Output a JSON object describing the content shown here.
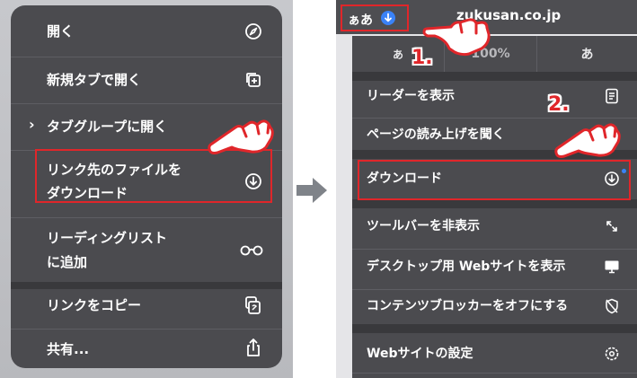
{
  "left_menu": {
    "items": [
      {
        "label": "開く",
        "icon": "compass-icon"
      },
      {
        "label": "新規タブで開く",
        "icon": "new-tab-icon"
      },
      {
        "label": "タブグループに開く",
        "chevron": "›"
      },
      {
        "label_line1": "リンク先のファイルを",
        "label_line2": "ダウンロード",
        "icon": "download-icon"
      },
      {
        "label_line1": "リーディングリスト",
        "label_line2": "に追加",
        "icon": "glasses-icon"
      },
      {
        "label": "リンクをコピー",
        "icon": "copy-icon"
      },
      {
        "label": "共有...",
        "icon": "share-icon"
      }
    ]
  },
  "right_panel": {
    "aa_label": "ぁあ",
    "url": "zukusan.co.jp",
    "font_small": "あ",
    "zoom": "100%",
    "font_large": "あ",
    "items": [
      {
        "label": "リーダーを表示",
        "icon": "reader-icon"
      },
      {
        "label": "ページの読み上げを聞く",
        "icon": "speaker-icon"
      },
      {
        "label": "ダウンロード",
        "icon": "download-icon"
      },
      {
        "label": "ツールバーを非表示",
        "icon": "resize-icon"
      },
      {
        "label": "デスクトップ用 Webサイトを表示",
        "icon": "desktop-icon"
      },
      {
        "label": "コンテンツブロッカーをオフにする",
        "icon": "blocker-off-icon"
      },
      {
        "label": "Webサイトの設定",
        "icon": "settings-icon"
      }
    ]
  },
  "annotations": {
    "step1": "1.",
    "step2": "2."
  },
  "colors": {
    "highlight": "#e0262a",
    "menu_bg": "#4b4b4f",
    "accent_blue": "#3a82f7"
  }
}
